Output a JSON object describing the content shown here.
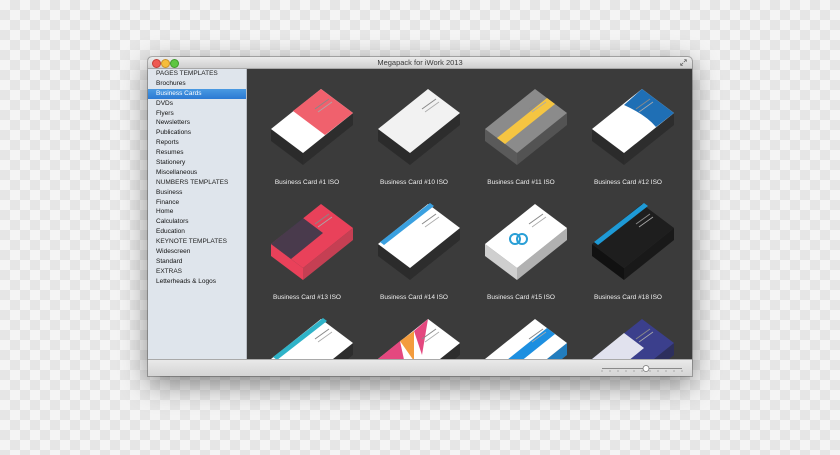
{
  "window": {
    "title": "Megapack for iWork 2013",
    "colors": {
      "content_bg": "#3b3b3b",
      "selection": "#2b79d3",
      "sidebar_bg": "#dfe5ec"
    }
  },
  "sidebar": {
    "items": [
      {
        "label": "PAGES TEMPLATES",
        "type": "section"
      },
      {
        "label": "Brochures",
        "type": "item"
      },
      {
        "label": "Business Cards",
        "type": "item",
        "selected": true
      },
      {
        "label": "DVDs",
        "type": "item"
      },
      {
        "label": "Flyers",
        "type": "item"
      },
      {
        "label": "Newsletters",
        "type": "item"
      },
      {
        "label": "Publications",
        "type": "item"
      },
      {
        "label": "Reports",
        "type": "item"
      },
      {
        "label": "Resumes",
        "type": "item"
      },
      {
        "label": "Stationery",
        "type": "item"
      },
      {
        "label": "Miscellaneous",
        "type": "item"
      },
      {
        "label": "NUMBERS TEMPLATES",
        "type": "section"
      },
      {
        "label": "Business",
        "type": "item"
      },
      {
        "label": "Finance",
        "type": "item"
      },
      {
        "label": "Home",
        "type": "item"
      },
      {
        "label": "Calculators",
        "type": "item"
      },
      {
        "label": "Education",
        "type": "item"
      },
      {
        "label": "KEYNOTE TEMPLATES",
        "type": "section"
      },
      {
        "label": "Widescreen",
        "type": "item"
      },
      {
        "label": "Standard",
        "type": "item"
      },
      {
        "label": "EXTRAS",
        "type": "section"
      },
      {
        "label": "Letterheads & Logos",
        "type": "item"
      }
    ]
  },
  "templates": [
    {
      "label": "Business Card #1 ISO",
      "top": "#ffffff",
      "accent": "#f0616d",
      "side": "#2b2b2b",
      "accent_style": "diagonal"
    },
    {
      "label": "Business Card #10 ISO",
      "top": "#f2f2f2",
      "accent": "#8a8a8a",
      "side": "#2b2b2b",
      "accent_style": "none"
    },
    {
      "label": "Business Card #11 ISO",
      "top": "#8b8b8b",
      "accent": "#f5c542",
      "side": "#5a5a5a",
      "accent_style": "band"
    },
    {
      "label": "Business Card #12 ISO",
      "top": "#ffffff",
      "accent": "#1f6fb5",
      "side": "#2b2b2b",
      "accent_style": "wave"
    },
    {
      "label": "Business Card #13 ISO",
      "top": "#e9415a",
      "accent": "#2d3a4a",
      "side": "#e9415a",
      "accent_style": "block"
    },
    {
      "label": "Business Card #14 ISO",
      "top": "#ffffff",
      "accent": "#3aa0e0",
      "side": "#2b2b2b",
      "accent_style": "stripe"
    },
    {
      "label": "Business Card #15 ISO",
      "top": "#ffffff",
      "accent": "#2a9fd6",
      "side": "#cfcfcf",
      "accent_style": "logo"
    },
    {
      "label": "Business Card #18 ISO",
      "top": "#1e1e1e",
      "accent": "#1e9ad6",
      "side": "#111111",
      "accent_style": "stripe"
    },
    {
      "label": "",
      "top": "#ffffff",
      "accent": "#2fb3c8",
      "side": "#2b2b2b",
      "accent_style": "stripe"
    },
    {
      "label": "",
      "top": "#ffffff",
      "accent": "#e4487f",
      "side": "#2b2b2b",
      "accent_style": "rays"
    },
    {
      "label": "",
      "top": "#ffffff",
      "accent": "#1d8fe0",
      "side": "#1d8fe0",
      "accent_style": "band"
    },
    {
      "label": "",
      "top": "#3b3f8c",
      "accent": "#ffffff",
      "side": "#2a2d66",
      "accent_style": "block"
    }
  ],
  "zoom": {
    "level": 0.55
  }
}
